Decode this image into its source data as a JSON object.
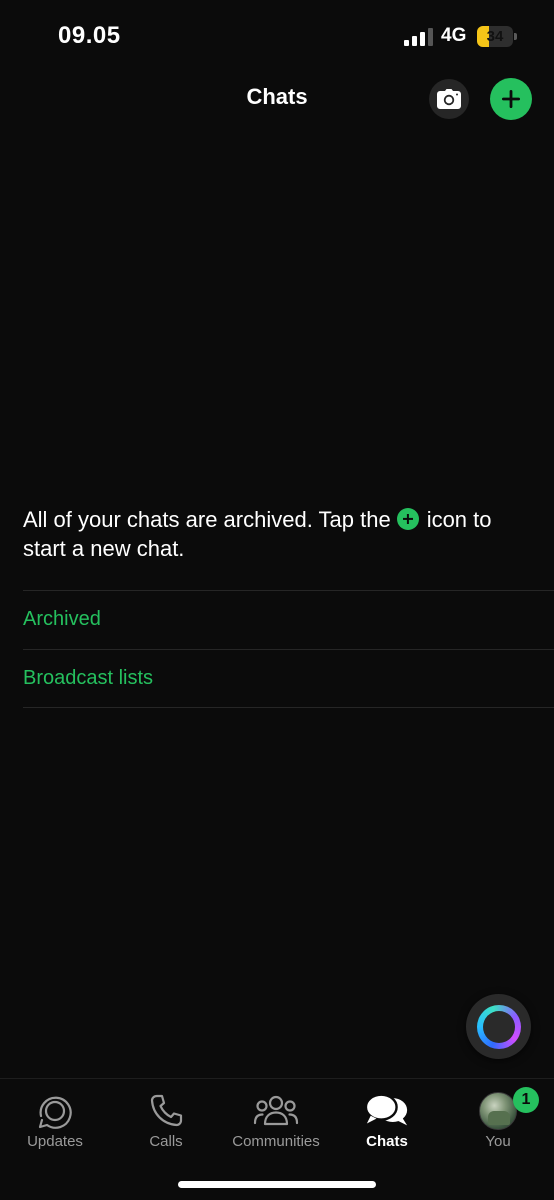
{
  "status_bar": {
    "time": "09.05",
    "network": "4G",
    "battery_level": "34",
    "battery_fill_fraction": 0.34
  },
  "header": {
    "title": "Chats",
    "camera_icon": "camera-icon",
    "new_chat_icon": "plus-icon"
  },
  "empty_state": {
    "message_before": "All of your chats are archived. Tap the",
    "message_after": "icon to start a new chat."
  },
  "links": {
    "archived": "Archived",
    "broadcast_lists": "Broadcast lists"
  },
  "tabs": [
    {
      "label": "Updates",
      "icon": "updates-icon",
      "active": false
    },
    {
      "label": "Calls",
      "icon": "phone-icon",
      "active": false
    },
    {
      "label": "Communities",
      "icon": "communities-icon",
      "active": false
    },
    {
      "label": "Chats",
      "icon": "chats-icon",
      "active": true
    },
    {
      "label": "You",
      "icon": "avatar",
      "active": false,
      "badge": "1"
    }
  ],
  "colors": {
    "accent": "#25c05e",
    "background": "#0b0b0b",
    "battery": "#f5c518"
  }
}
